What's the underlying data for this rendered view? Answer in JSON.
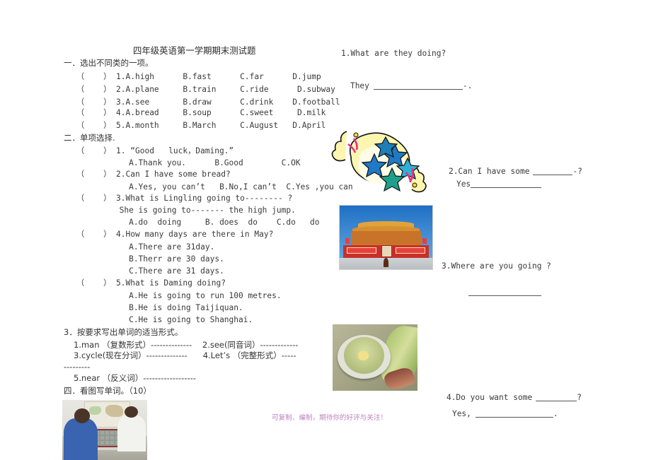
{
  "document": {
    "title": "四年级英语第一学期期末测试题",
    "watermark": "可复制、编制，期待你的好评与关注！"
  },
  "section1": {
    "heading": "一．选出不同类的一项。",
    "items": [
      "（    ） 1.A.high      B.fast      C.far      D.jump",
      "（    ） 2.A.plane     B.train     C.ride      D.subway",
      "（    ） 3.A.see       B.draw      C.drink    D.football",
      "（    ） 4.A.bread     B.soup      C.sweet     D.milk",
      "（    ） 5.A.month     B.March     C.August   D.April"
    ]
  },
  "section2": {
    "heading": "二．单项选择.",
    "lines": [
      "（    ） 1. “Good   luck，Daming.”",
      "           A.Thank you.      B.Good        C.OK",
      "（    ） 2.Can I have some bread?",
      "           A.Yes, you can’t   B.No,I can’t  C.Yes ,you can",
      "（    ） 3.What is Lingling going to-------- ?",
      "         She is going to------- the high jump.",
      "           A.do  doing     B. does  do    C.do   do",
      "（    ） 4.How many days are there in May?",
      "           A.There are 31day.",
      "           B.Therr are 30 days.",
      "           C.There are 31 days.",
      "（    ） 5.What is Daming doing?",
      "           A.He is going to run 100 metres.",
      "           B.He is doing Taijiquan.",
      "           C.He is going to Shanghai."
    ]
  },
  "section3": {
    "heading": "3．按要求写出单词的适当形式。",
    "lines": [
      "1.man （复数形式）--------------    2.see(同音词）-------------",
      "3.cycle(现在分词）--------------      4.Let’s （完整形式）-----",
      "---------",
      "5.near （反义词）------------------"
    ]
  },
  "section4": {
    "heading": "四．看图写单词。（10）"
  },
  "right_column": {
    "q1": {
      "question": "1.What are they doing?",
      "answer_prefix": "They",
      "answer_suffix": "-."
    },
    "q2": {
      "question_before": "2.Can I have some",
      "question_after": "-?",
      "answer_prefix": "Yes"
    },
    "q3": {
      "question": "3.Where are you going ?"
    },
    "q4": {
      "question_before": "4.Do you want some",
      "question_after": "?",
      "answer_prefix": "Yes,",
      "answer_suffix": "."
    }
  },
  "images": {
    "chess": "boys-playing-chess-photo",
    "candy": "wrapped-candy-clipart",
    "tiananmen": "tiananmen-gate-photo",
    "soup": "bowl-of-soup-photo"
  },
  "colors": {
    "watermark": "#b46ab4",
    "text": "#3a3a3a"
  }
}
